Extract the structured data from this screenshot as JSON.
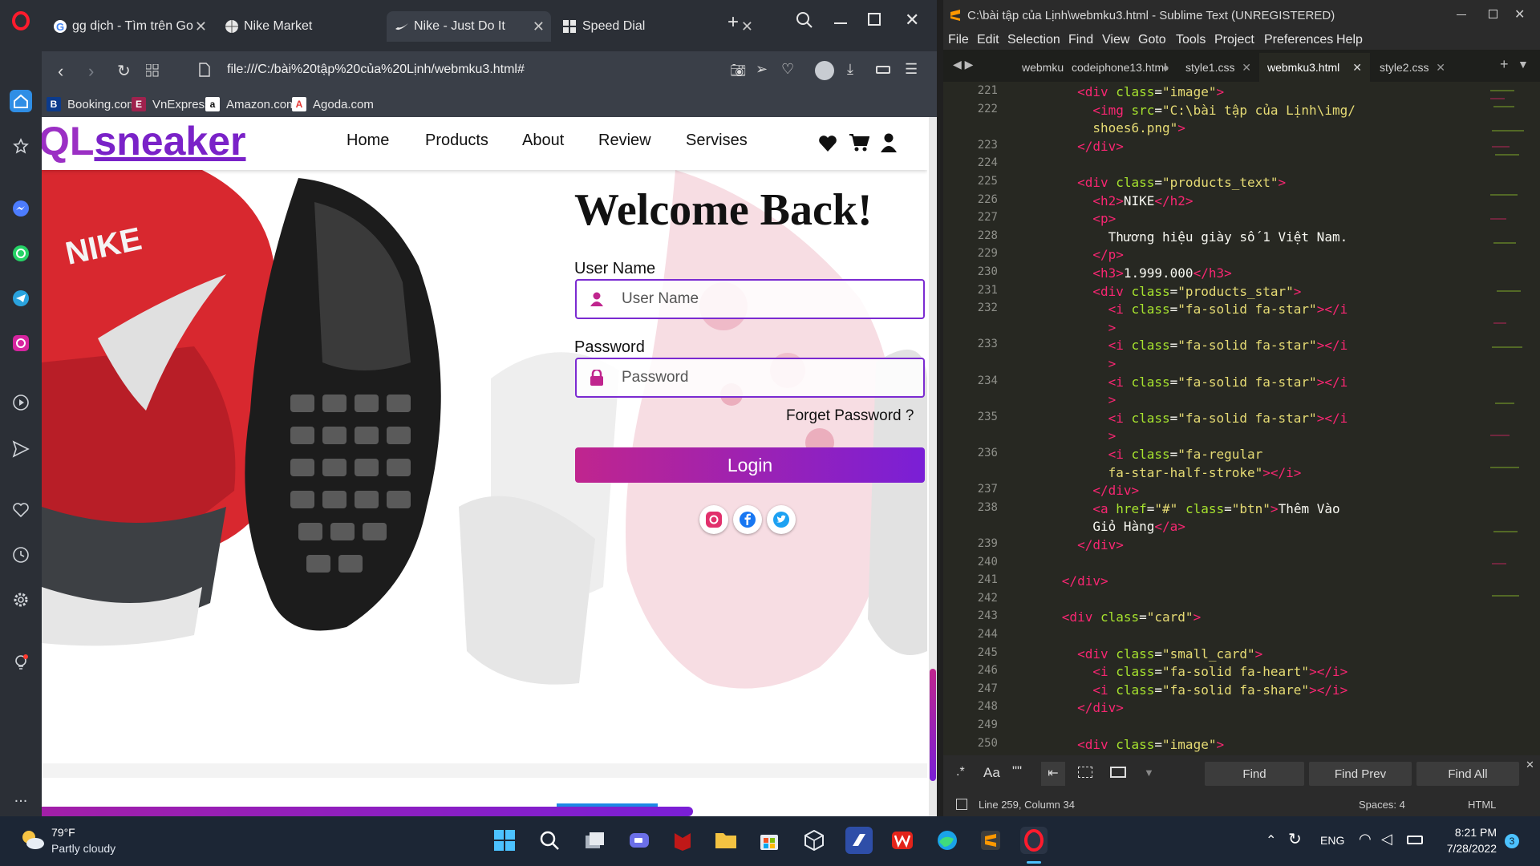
{
  "opera": {
    "sidebar_icons": [
      "opera-logo-icon",
      "home-icon",
      "speed-dial-icon",
      "messenger-icon",
      "whatsapp-icon",
      "telegram-icon",
      "instagram-icon",
      "player-icon",
      "send-icon",
      "heart-icon",
      "history-icon",
      "settings-icon",
      "lightbulb-icon",
      "more-icon"
    ],
    "more": "..."
  },
  "browser": {
    "tabs": [
      {
        "label": "gg dịch - Tìm trên Go",
        "icon": "google-icon"
      },
      {
        "label": "Nike Market",
        "icon": "globe-icon"
      },
      {
        "label": "Nike - Just Do It",
        "icon": "nike-icon"
      },
      {
        "label": "Speed Dial",
        "icon": "speed-dial-icon"
      }
    ],
    "new_tab": "+",
    "url": "file:///C:/bài%20tập%20của%20Lịnh/webmku3.html#",
    "bookmarks": [
      {
        "label": "Booking.com",
        "letter": "B",
        "color": "#0c3b8c"
      },
      {
        "label": "VnExpress",
        "letter": "E",
        "color": "#9f224e"
      },
      {
        "label": "Amazon.com",
        "letter": "a",
        "color": "#ffffff"
      },
      {
        "label": "Agoda.com",
        "letter": "A",
        "color": "#ffffff"
      }
    ]
  },
  "site": {
    "logo_prefix": "QL",
    "logo_main": "sneaker",
    "nav": [
      "Home",
      "Products",
      "About",
      "Review",
      "Servises"
    ],
    "welcome": "Welcome Back!",
    "username_label": "User Name",
    "username_placeholder": "User Name",
    "password_label": "Password",
    "password_placeholder": "Password",
    "forget": "Forget Password ?",
    "login": "Login",
    "accent_color": "#7a1fd6",
    "brand_color": "#9b2fc4"
  },
  "sublime": {
    "title": "C:\\bài tập của Lịnh\\webmku3.html - Sublime Text (UNREGISTERED)",
    "menu": [
      "File",
      "Edit",
      "Selection",
      "Find",
      "View",
      "Goto",
      "Tools",
      "Project",
      "Preferences",
      "Help"
    ],
    "tabs": [
      "webmku",
      "codeiphone13.html",
      "style1.css",
      "webmku3.html",
      "style2.css"
    ],
    "lines": [
      {
        "n": "221",
        "parts": [
          [
            "tx",
            "        "
          ],
          [
            "tg",
            "<div"
          ],
          [
            "at",
            " class"
          ],
          [
            "tx",
            "="
          ],
          [
            "st",
            "\"image\""
          ],
          [
            "tg",
            ">"
          ]
        ]
      },
      {
        "n": "222",
        "parts": [
          [
            "tx",
            "          "
          ],
          [
            "tg",
            "<img"
          ],
          [
            "at",
            " src"
          ],
          [
            "tx",
            "="
          ],
          [
            "st",
            "\"C:\\bài tập của Lịnh\\img/"
          ]
        ]
      },
      {
        "n": "",
        "parts": [
          [
            "st",
            "          shoes6.png\""
          ],
          [
            "tg",
            ">"
          ]
        ]
      },
      {
        "n": "223",
        "parts": [
          [
            "tx",
            "        "
          ],
          [
            "tg",
            "</div>"
          ]
        ]
      },
      {
        "n": "224",
        "parts": []
      },
      {
        "n": "225",
        "parts": [
          [
            "tx",
            "        "
          ],
          [
            "tg",
            "<div"
          ],
          [
            "at",
            " class"
          ],
          [
            "tx",
            "="
          ],
          [
            "st",
            "\"products_text\""
          ],
          [
            "tg",
            ">"
          ]
        ]
      },
      {
        "n": "226",
        "parts": [
          [
            "tx",
            "          "
          ],
          [
            "tg",
            "<h2>"
          ],
          [
            "tx",
            "NIKE"
          ],
          [
            "tg",
            "</h2>"
          ]
        ]
      },
      {
        "n": "227",
        "parts": [
          [
            "tx",
            "          "
          ],
          [
            "tg",
            "<p>"
          ]
        ]
      },
      {
        "n": "228",
        "parts": [
          [
            "tx",
            "            Thương hiệu giày số 1 Việt Nam."
          ]
        ]
      },
      {
        "n": "229",
        "parts": [
          [
            "tx",
            "          "
          ],
          [
            "tg",
            "</p>"
          ]
        ]
      },
      {
        "n": "230",
        "parts": [
          [
            "tx",
            "          "
          ],
          [
            "tg",
            "<h3>"
          ],
          [
            "tx",
            "1.999.000"
          ],
          [
            "tg",
            "</h3>"
          ]
        ]
      },
      {
        "n": "231",
        "parts": [
          [
            "tx",
            "          "
          ],
          [
            "tg",
            "<div"
          ],
          [
            "at",
            " class"
          ],
          [
            "tx",
            "="
          ],
          [
            "st",
            "\"products_star\""
          ],
          [
            "tg",
            ">"
          ]
        ]
      },
      {
        "n": "232",
        "parts": [
          [
            "tx",
            "            "
          ],
          [
            "tg",
            "<i"
          ],
          [
            "at",
            " class"
          ],
          [
            "tx",
            "="
          ],
          [
            "st",
            "\"fa-solid fa-star\""
          ],
          [
            "tg",
            "></i"
          ]
        ]
      },
      {
        "n": "",
        "parts": [
          [
            "tg",
            "            >"
          ]
        ]
      },
      {
        "n": "233",
        "parts": [
          [
            "tx",
            "            "
          ],
          [
            "tg",
            "<i"
          ],
          [
            "at",
            " class"
          ],
          [
            "tx",
            "="
          ],
          [
            "st",
            "\"fa-solid fa-star\""
          ],
          [
            "tg",
            "></i"
          ]
        ]
      },
      {
        "n": "",
        "parts": [
          [
            "tg",
            "            >"
          ]
        ]
      },
      {
        "n": "234",
        "parts": [
          [
            "tx",
            "            "
          ],
          [
            "tg",
            "<i"
          ],
          [
            "at",
            " class"
          ],
          [
            "tx",
            "="
          ],
          [
            "st",
            "\"fa-solid fa-star\""
          ],
          [
            "tg",
            "></i"
          ]
        ]
      },
      {
        "n": "",
        "parts": [
          [
            "tg",
            "            >"
          ]
        ]
      },
      {
        "n": "235",
        "parts": [
          [
            "tx",
            "            "
          ],
          [
            "tg",
            "<i"
          ],
          [
            "at",
            " class"
          ],
          [
            "tx",
            "="
          ],
          [
            "st",
            "\"fa-solid fa-star\""
          ],
          [
            "tg",
            "></i"
          ]
        ]
      },
      {
        "n": "",
        "parts": [
          [
            "tg",
            "            >"
          ]
        ]
      },
      {
        "n": "236",
        "parts": [
          [
            "tx",
            "            "
          ],
          [
            "tg",
            "<i"
          ],
          [
            "at",
            " class"
          ],
          [
            "tx",
            "="
          ],
          [
            "st",
            "\"fa-regular"
          ]
        ]
      },
      {
        "n": "",
        "parts": [
          [
            "st",
            "            fa-star-half-stroke\""
          ],
          [
            "tg",
            "></i>"
          ]
        ]
      },
      {
        "n": "237",
        "parts": [
          [
            "tx",
            "          "
          ],
          [
            "tg",
            "</div>"
          ]
        ]
      },
      {
        "n": "238",
        "parts": [
          [
            "tx",
            "          "
          ],
          [
            "tg",
            "<a"
          ],
          [
            "at",
            " href"
          ],
          [
            "tx",
            "="
          ],
          [
            "st",
            "\"#\""
          ],
          [
            "at",
            " class"
          ],
          [
            "tx",
            "="
          ],
          [
            "st",
            "\"btn\""
          ],
          [
            "tg",
            ">"
          ],
          [
            "tx",
            "Thêm Vào"
          ]
        ]
      },
      {
        "n": "",
        "parts": [
          [
            "tx",
            "          Giỏ Hàng"
          ],
          [
            "tg",
            "</a>"
          ]
        ]
      },
      {
        "n": "239",
        "parts": [
          [
            "tx",
            "        "
          ],
          [
            "tg",
            "</div>"
          ]
        ]
      },
      {
        "n": "240",
        "parts": []
      },
      {
        "n": "241",
        "parts": [
          [
            "tx",
            "      "
          ],
          [
            "tg",
            "</div>"
          ]
        ]
      },
      {
        "n": "242",
        "parts": []
      },
      {
        "n": "243",
        "parts": [
          [
            "tx",
            "      "
          ],
          [
            "tg",
            "<div"
          ],
          [
            "at",
            " class"
          ],
          [
            "tx",
            "="
          ],
          [
            "st",
            "\"card\""
          ],
          [
            "tg",
            ">"
          ]
        ]
      },
      {
        "n": "244",
        "parts": []
      },
      {
        "n": "245",
        "parts": [
          [
            "tx",
            "        "
          ],
          [
            "tg",
            "<div"
          ],
          [
            "at",
            " class"
          ],
          [
            "tx",
            "="
          ],
          [
            "st",
            "\"small_card\""
          ],
          [
            "tg",
            ">"
          ]
        ]
      },
      {
        "n": "246",
        "parts": [
          [
            "tx",
            "          "
          ],
          [
            "tg",
            "<i"
          ],
          [
            "at",
            " class"
          ],
          [
            "tx",
            "="
          ],
          [
            "st",
            "\"fa-solid fa-heart\""
          ],
          [
            "tg",
            "></i>"
          ]
        ]
      },
      {
        "n": "247",
        "parts": [
          [
            "tx",
            "          "
          ],
          [
            "tg",
            "<i"
          ],
          [
            "at",
            " class"
          ],
          [
            "tx",
            "="
          ],
          [
            "st",
            "\"fa-solid fa-share\""
          ],
          [
            "tg",
            "></i>"
          ]
        ]
      },
      {
        "n": "248",
        "parts": [
          [
            "tx",
            "        "
          ],
          [
            "tg",
            "</div>"
          ]
        ]
      },
      {
        "n": "249",
        "parts": []
      },
      {
        "n": "250",
        "parts": [
          [
            "tx",
            "        "
          ],
          [
            "tg",
            "<div"
          ],
          [
            "at",
            " class"
          ],
          [
            "tx",
            "="
          ],
          [
            "st",
            "\"image\""
          ],
          [
            "tg",
            ">"
          ]
        ]
      }
    ],
    "find_buttons": [
      "Find",
      "Find Prev",
      "Find All"
    ],
    "find_options": [
      ".*",
      "Aa",
      "\"\""
    ],
    "status_position": "Line 259, Column 34",
    "status_spaces": "Spaces: 4",
    "status_syntax": "HTML"
  },
  "taskbar": {
    "weather_temp": "79°F",
    "weather_desc": "Partly cloudy",
    "language": "ENG",
    "time": "8:21 PM",
    "date": "7/28/2022",
    "notifications": "3"
  }
}
